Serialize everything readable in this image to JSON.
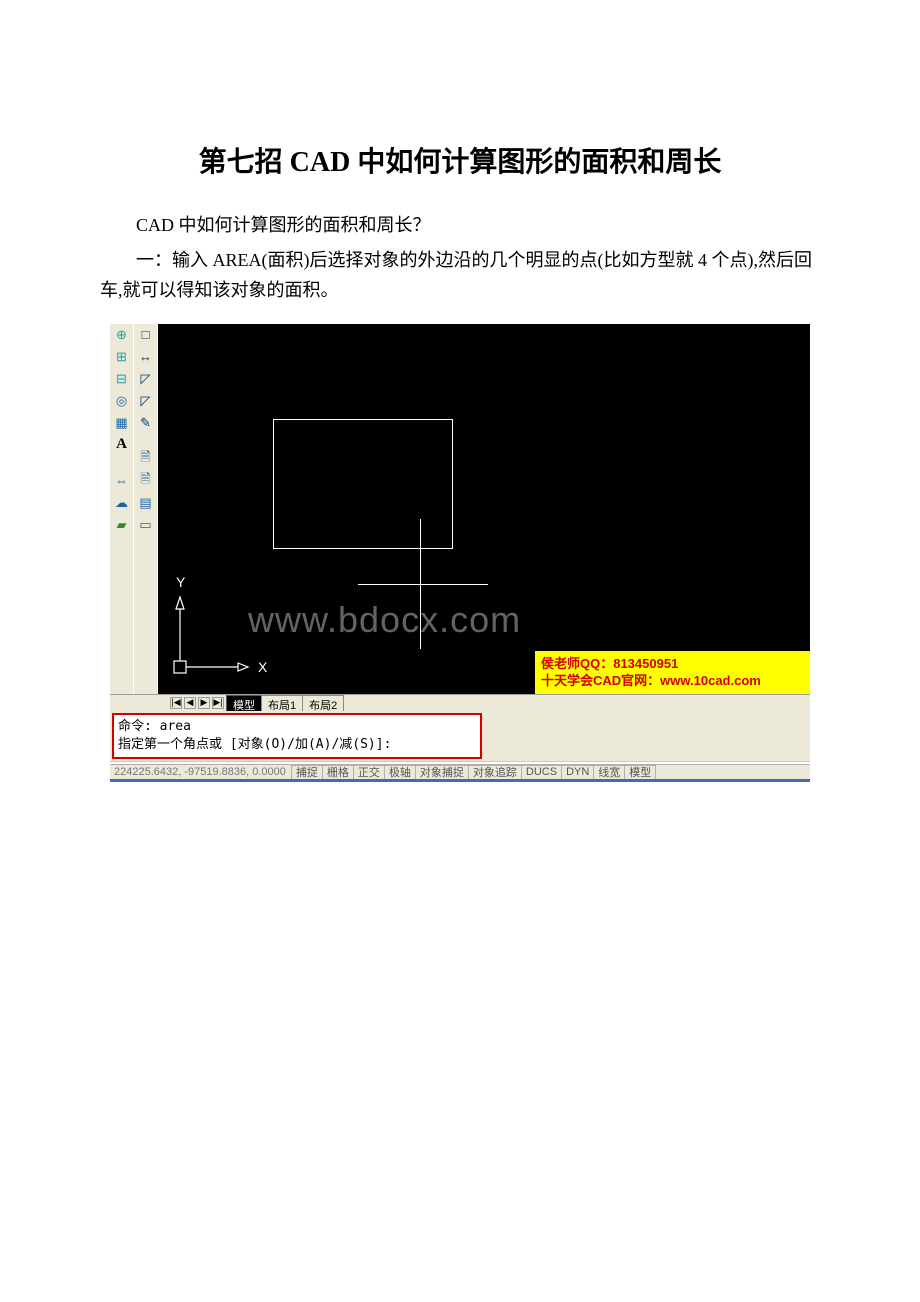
{
  "title": "第七招 CAD 中如何计算图形的面积和周长",
  "para1": "CAD 中如何计算图形的面积和周长？",
  "para2": "一：输入 AREA(面积)后选择对象的外边沿的几个明显的点(比如方型就 4 个点),然后回车,就可以得知该对象的面积。",
  "watermark": "www.bdocx.com",
  "ucs": {
    "x": "X",
    "y": "Y"
  },
  "promo": {
    "line1": "侯老师QQ：813450951",
    "line2": "十天学会CAD官网：www.10cad.com"
  },
  "tabs": {
    "nav": {
      "first": "|◀",
      "prev": "◀",
      "next": "▶",
      "last": "▶|"
    },
    "model": "模型",
    "layout1": "布局1",
    "layout2": "布局2"
  },
  "cmd": {
    "line1": "命令: area",
    "line2": "指定第一个角点或 [对象(O)/加(A)/减(S)]:"
  },
  "status": {
    "coords": "224225.6432, -97519.8836, 0.0000",
    "snap": "捕捉",
    "grid": "栅格",
    "ortho": "正交",
    "polar": "极轴",
    "osnap": "对象捕捉",
    "otrack": "对象追踪",
    "ducs": "DUCS",
    "dyn": "DYN",
    "lwt": "线宽",
    "model": "模型"
  },
  "tools_left": [
    "⊕",
    "⊞",
    "⊟",
    "◎",
    "▦",
    "A",
    "",
    "⇔",
    "☁",
    "▰"
  ],
  "tools_right": [
    "□",
    "↔",
    "◸",
    "◸",
    "✎",
    "",
    "🗎",
    "🗎",
    "▤",
    "▭"
  ]
}
